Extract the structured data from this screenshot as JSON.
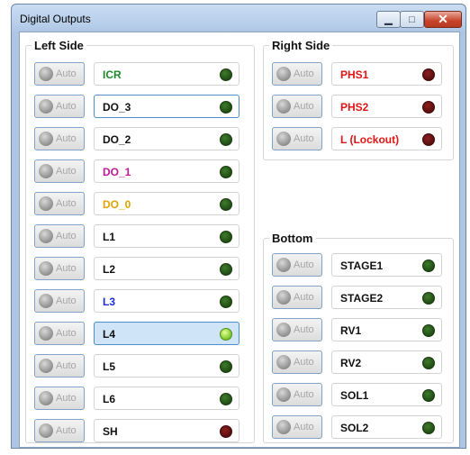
{
  "window": {
    "title": "Digital Outputs",
    "min_icon": "minimize-icon",
    "max_icon": "maximize-icon",
    "close_icon": "close-icon"
  },
  "auto_label": "Auto",
  "colors": {
    "green": "#1f8a2d",
    "black": "#111111",
    "magenta": "#c2189a",
    "orange": "#e0a400",
    "blue": "#1e2fd6",
    "red": "#e01515"
  },
  "left": {
    "label": "Left Side",
    "rows": [
      {
        "name": "ICR",
        "color": "#1f8a2d",
        "led": "green",
        "state": ""
      },
      {
        "name": "DO_3",
        "color": "#111111",
        "led": "green",
        "state": "focus"
      },
      {
        "name": "DO_2",
        "color": "#111111",
        "led": "green",
        "state": ""
      },
      {
        "name": "DO_1",
        "color": "#c2189a",
        "led": "green",
        "state": ""
      },
      {
        "name": "DO_0",
        "color": "#e0a400",
        "led": "green",
        "state": ""
      },
      {
        "name": "L1",
        "color": "#111111",
        "led": "green",
        "state": ""
      },
      {
        "name": "L2",
        "color": "#111111",
        "led": "green",
        "state": ""
      },
      {
        "name": "L3",
        "color": "#1e2fd6",
        "led": "green",
        "state": ""
      },
      {
        "name": "L4",
        "color": "#111111",
        "led": "lit",
        "state": "sel"
      },
      {
        "name": "L5",
        "color": "#111111",
        "led": "green",
        "state": ""
      },
      {
        "name": "L6",
        "color": "#111111",
        "led": "green",
        "state": ""
      },
      {
        "name": "SH",
        "color": "#111111",
        "led": "red",
        "state": ""
      }
    ]
  },
  "right": {
    "label": "Right Side",
    "rows": [
      {
        "name": "PHS1",
        "color": "#e01515",
        "led": "red",
        "state": ""
      },
      {
        "name": "PHS2",
        "color": "#e01515",
        "led": "red",
        "state": ""
      },
      {
        "name": "L (Lockout)",
        "color": "#e01515",
        "led": "red",
        "state": ""
      }
    ]
  },
  "bottom": {
    "label": "Bottom",
    "rows": [
      {
        "name": "STAGE1",
        "color": "#111111",
        "led": "green",
        "state": ""
      },
      {
        "name": "STAGE2",
        "color": "#111111",
        "led": "green",
        "state": ""
      },
      {
        "name": "RV1",
        "color": "#111111",
        "led": "green",
        "state": ""
      },
      {
        "name": "RV2",
        "color": "#111111",
        "led": "green",
        "state": ""
      },
      {
        "name": "SOL1",
        "color": "#111111",
        "led": "green",
        "state": ""
      },
      {
        "name": "SOL2",
        "color": "#111111",
        "led": "green",
        "state": ""
      }
    ]
  }
}
